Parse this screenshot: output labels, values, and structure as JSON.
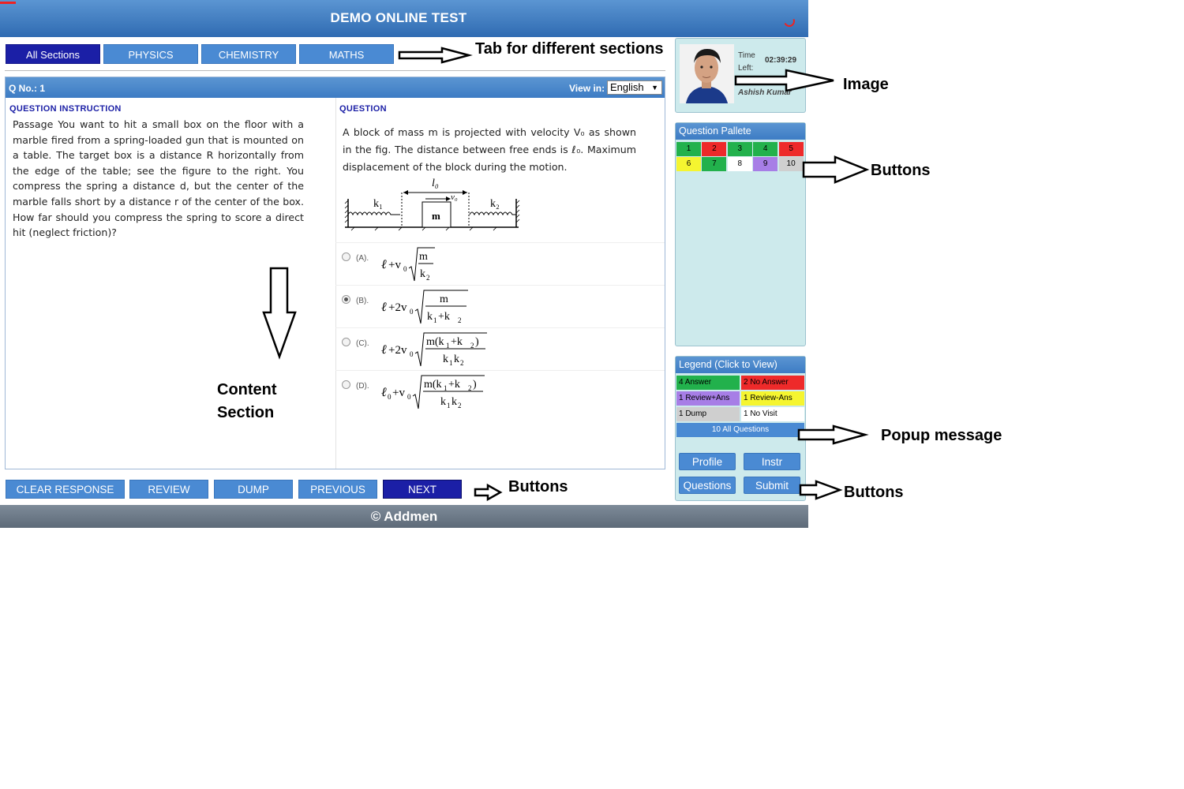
{
  "header": {
    "title": "DEMO ONLINE TEST"
  },
  "tabs": [
    {
      "label": "All Sections",
      "active": true
    },
    {
      "label": "PHYSICS",
      "active": false
    },
    {
      "label": "CHEMISTRY",
      "active": false
    },
    {
      "label": "MATHS",
      "active": false
    }
  ],
  "question_panel": {
    "qno_label": "Q No.: 1",
    "view_in_label": "View in:",
    "language": "English",
    "instruction_heading": "QUESTION INSTRUCTION",
    "question_heading": "QUESTION",
    "instruction_text": "Passage You want to hit a small box on the floor with a marble fired from a spring-loaded gun that is mounted on a table. The target box is a distance R horizontally from the edge of the table; see the figure to the right. You compress the spring a distance d, but the center of the marble falls short by a distance r of the center of the box. How far should you compress the spring to score a direct hit (neglect friction)?",
    "question_text": "A block of mass m is projected with velocity V₀ as shown in the fig. The distance between free ends is ℓ₀. Maximum displacement of the block during the motion.",
    "figure_labels": {
      "length": "l₀",
      "k1": "k₁",
      "k2": "k₂",
      "velocity": "v₀",
      "mass": "m"
    },
    "options": [
      {
        "letter": "(A).",
        "selected": false
      },
      {
        "letter": "(B).",
        "selected": true
      },
      {
        "letter": "(C).",
        "selected": false
      },
      {
        "letter": "(D).",
        "selected": false
      }
    ]
  },
  "bottom_buttons": {
    "clear": "CLEAR RESPONSE",
    "review": "REVIEW",
    "dump": "DUMP",
    "previous": "PREVIOUS",
    "next": "NEXT"
  },
  "footer": {
    "text": "© Addmen"
  },
  "profile": {
    "time_label_1": "Time",
    "time_label_2": "Left:",
    "time_left": "02:39:29",
    "name": "Ashish Kumar"
  },
  "pallete": {
    "title": "Question Pallete",
    "cells": [
      {
        "num": "1",
        "color": "#22b14c"
      },
      {
        "num": "2",
        "color": "#ee2a2a"
      },
      {
        "num": "3",
        "color": "#22b14c"
      },
      {
        "num": "4",
        "color": "#22b14c"
      },
      {
        "num": "5",
        "color": "#ee2a2a"
      },
      {
        "num": "6",
        "color": "#f5f530"
      },
      {
        "num": "7",
        "color": "#22b14c"
      },
      {
        "num": "8",
        "color": "#ffffff"
      },
      {
        "num": "9",
        "color": "#a77ee6"
      },
      {
        "num": "10",
        "color": "#cfcfcf"
      }
    ]
  },
  "legend": {
    "title": "Legend (Click to View)",
    "answer": "4 Answer",
    "no_answer": "2 No Answer",
    "review_ans": "1 Review+Ans",
    "review_no_ans": "1 Review-Ans",
    "dump": "1 Dump",
    "no_visit": "1 No Visit",
    "all_questions": "10 All Questions"
  },
  "side_buttons": {
    "profile": "Profile",
    "instr": "Instr",
    "questions": "Questions",
    "submit": "Submit"
  },
  "annotations": {
    "tabs": "Tab for different sections",
    "image": "Image",
    "pallete_buttons": "Buttons",
    "content_1": "Content",
    "content_2": "Section",
    "popup": "Popup message",
    "bottom_buttons": "Buttons",
    "side_buttons": "Buttons"
  },
  "colors": {
    "header_blue": "#3d7cc4",
    "active_tab": "#1b1fa6",
    "panel_bg": "#cdeaec"
  }
}
